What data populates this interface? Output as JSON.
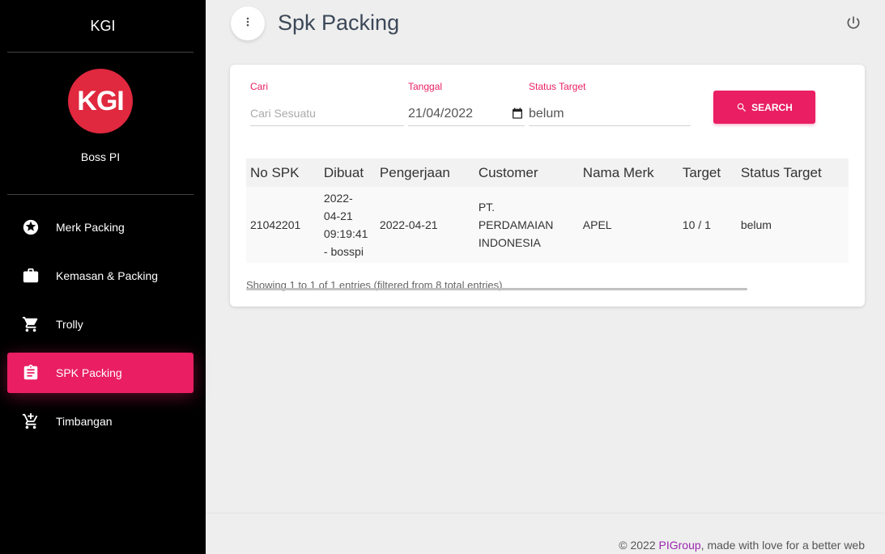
{
  "sidebar": {
    "brand": "KGI",
    "logo_text": "KGI",
    "user_name": "Boss PI",
    "items": [
      {
        "label": "Merk Packing",
        "icon": "star-circle-icon",
        "active": false
      },
      {
        "label": "Kemasan & Packing",
        "icon": "briefcase-icon",
        "active": false
      },
      {
        "label": "Trolly",
        "icon": "shopping-cart-icon",
        "active": false
      },
      {
        "label": "SPK Packing",
        "icon": "clipboard-icon",
        "active": true
      },
      {
        "label": "Timbangan",
        "icon": "add-shopping-cart-icon",
        "active": false
      }
    ]
  },
  "header": {
    "title": "Spk Packing",
    "menu_icon": "more-vertical-icon",
    "power_icon": "power-icon"
  },
  "filters": {
    "cari_label": "Cari",
    "cari_placeholder": "Cari Sesuatu",
    "tanggal_label": "Tanggal",
    "tanggal_value": "21/04/2022",
    "status_label": "Status Target",
    "status_value": "belum",
    "search_button": "SEARCH"
  },
  "table": {
    "columns": [
      "No SPK",
      "Dibuat",
      "Pengerjaan",
      "Customer",
      "Nama Merk",
      "Target",
      "Status Target"
    ],
    "rows": [
      {
        "no_spk": "21042201",
        "dibuat": [
          "2022-",
          "04-21",
          "09:19:41",
          "- bosspi"
        ],
        "pengerjaan": "2022-04-21",
        "customer": [
          "PT.",
          "PERDAMAIAN",
          "INDONESIA"
        ],
        "nama_merk": "APEL",
        "target": "10 / 1",
        "status_target": "belum"
      }
    ],
    "info": "Showing 1 to 1 of 1 entries (filtered from 8 total entries)"
  },
  "footer": {
    "prefix": "© 2022 ",
    "link": "PIGroup",
    "suffix": ", made with love for a better web"
  },
  "colors": {
    "accent": "#e91e63",
    "sidebar_bg": "#000000",
    "logo_bg": "#e0283e",
    "footer_link": "#9c27b0"
  }
}
